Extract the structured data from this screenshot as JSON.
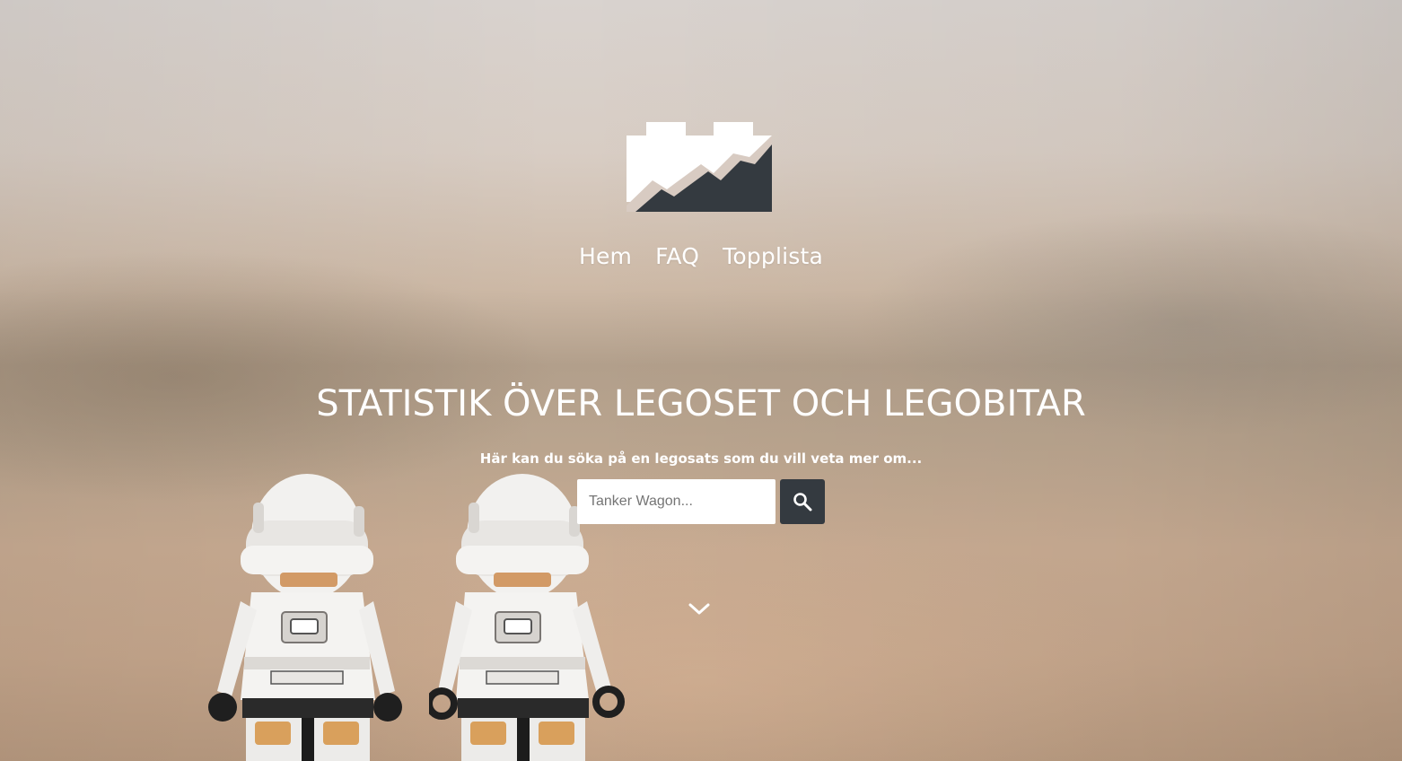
{
  "nav": {
    "items": [
      {
        "label": "Hem"
      },
      {
        "label": "FAQ"
      },
      {
        "label": "Topplista"
      }
    ]
  },
  "hero": {
    "title": "STATISTIK ÖVER LEGOSET OCH LEGOBITAR",
    "subtitle": "Här kan du söka på en legosats som du vill veta mer om..."
  },
  "search": {
    "placeholder": "Tanker Wagon...",
    "value": ""
  },
  "icons": {
    "logo": "lego-brick-chart-logo",
    "search": "search-icon",
    "scroll": "chevron-down-icon"
  },
  "colors": {
    "dark": "#343a40",
    "white": "#ffffff"
  }
}
